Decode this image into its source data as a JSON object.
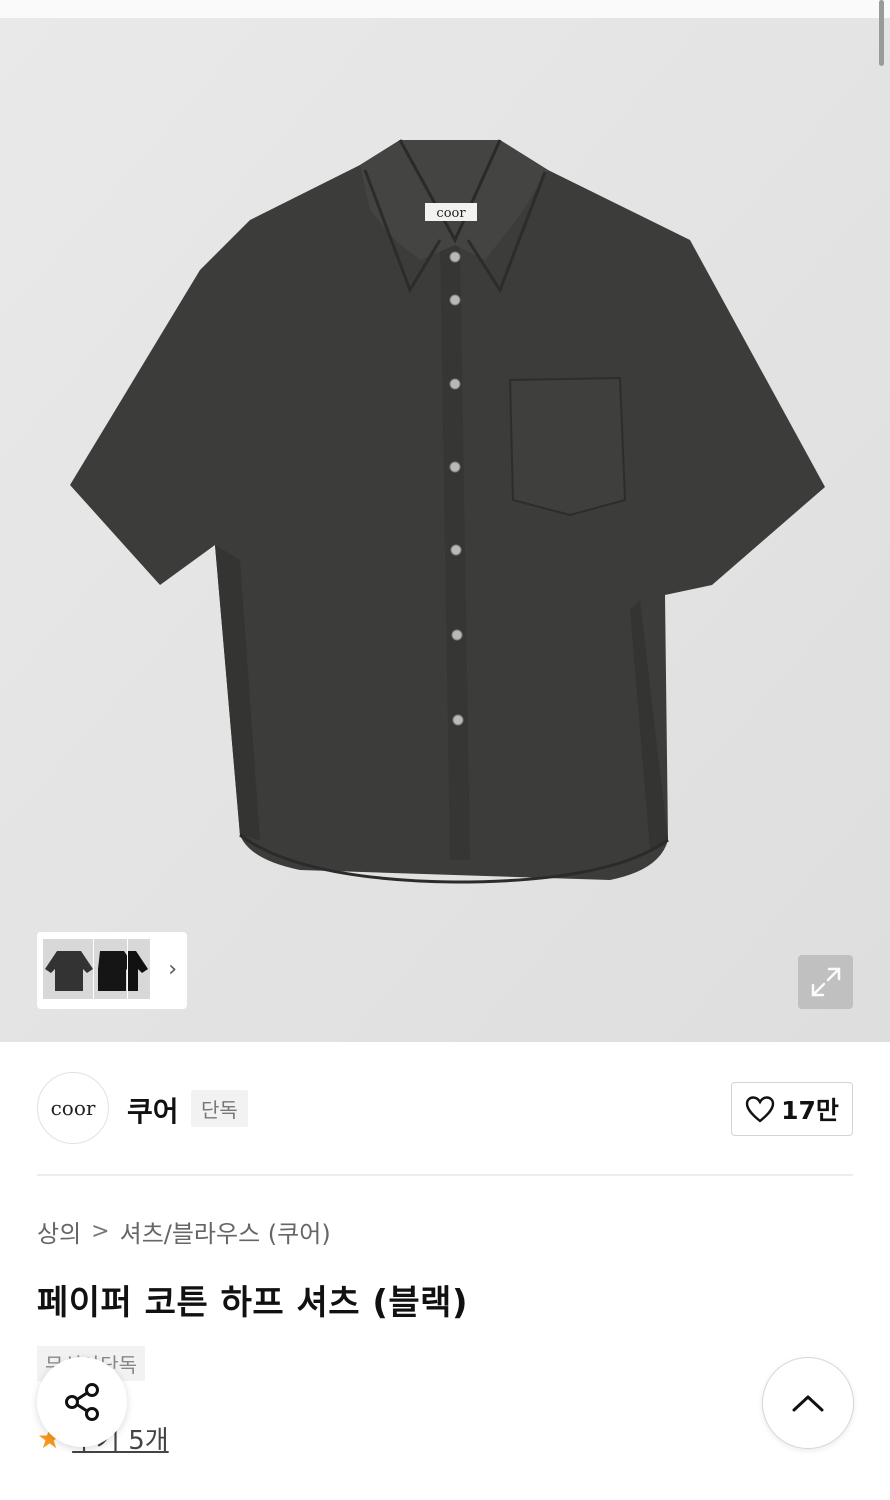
{
  "product_image": {
    "label_text": "coor"
  },
  "thumbnails": {
    "items": [
      "thumbnail-charcoal",
      "thumbnail-black",
      "thumbnail-black-2"
    ],
    "next_icon": "chevron-right-icon"
  },
  "expand": {
    "icon": "expand-icon"
  },
  "brand": {
    "logo_text": "coor",
    "name": "쿠어",
    "badge": "단독",
    "likes": "17만",
    "like_icon": "heart-icon"
  },
  "breadcrumb": {
    "items": [
      "상의",
      "셔츠/블라우스 (쿠어)"
    ],
    "separator": ">"
  },
  "product": {
    "title": "페이퍼 코튼 하프 셔츠 (블랙)",
    "exclusive_badge": "무신사단독",
    "reviews": "후기 5개"
  },
  "floating": {
    "share_icon": "share-icon",
    "top_icon": "chevron-up-icon"
  },
  "colors": {
    "shirt": "#3d3d3b",
    "background": "#e6e6e6",
    "star": "#f79a1b"
  }
}
